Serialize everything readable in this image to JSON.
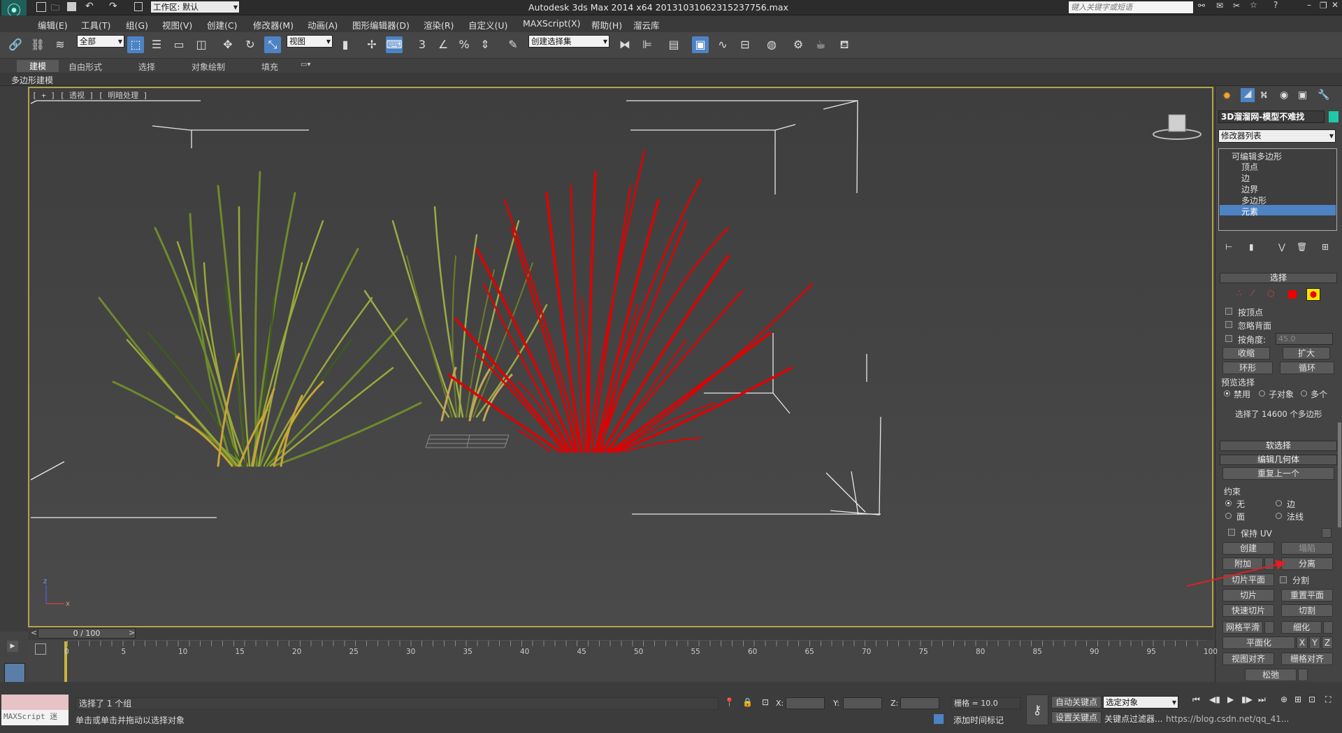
{
  "window": {
    "title": "Autodesk 3ds Max  2014 x64      20131031062315237756.max",
    "workspace": "工作区: 默认",
    "search_placeholder": "键入关键字或短语"
  },
  "menu": [
    "编辑(E)",
    "工具(T)",
    "组(G)",
    "视图(V)",
    "创建(C)",
    "修改器(M)",
    "动画(A)",
    "图形编辑器(D)",
    "渲染(R)",
    "自定义(U)",
    "MAXScript(X)",
    "帮助(H)",
    "溜云库"
  ],
  "toolbar": {
    "filter": "全部",
    "refcoord": "视图",
    "selection_set": "创建选择集"
  },
  "ribbon": {
    "tabs": [
      "建模",
      "自由形式",
      "选择",
      "对象绘制",
      "填充"
    ],
    "sub": "多边形建模"
  },
  "viewport": {
    "label": "[ + ] [ 透视 ] [ 明暗处理 ]",
    "axis_z": "z",
    "axis_x": "x"
  },
  "panel": {
    "object_name": "3D溜溜网-模型不难找",
    "modifier_list": "修改器列表",
    "stack": [
      "可编辑多边形",
      "顶点",
      "边",
      "边界",
      "多边形",
      "元素"
    ],
    "stack_selected": 5,
    "select": {
      "title": "选择",
      "by_vertex": "按顶点",
      "ignore_backface": "忽略背面",
      "by_angle": "按角度:",
      "angle_value": "45.0",
      "shrink": "收缩",
      "grow": "扩大",
      "ring": "环形",
      "loop": "循环",
      "preview": "预览选择",
      "disabled": "禁用",
      "subobject": "子对象",
      "multiple": "多个",
      "status": "选择了 14600 个多边形"
    },
    "soft_select": "软选择",
    "edit_geo": {
      "title": "编辑几何体",
      "repeat": "重复上一个",
      "constraint": "约束",
      "none": "无",
      "edge": "边",
      "face": "面",
      "normal": "法线",
      "keep_uv": "保持 UV",
      "create": "创建",
      "collapse": "塌陷",
      "attach": "附加",
      "detach": "分离",
      "slice_plane": "切片平面",
      "split": "分割",
      "slice": "切片",
      "reset_plane": "重置平面",
      "quick_slice": "快速切片",
      "cut": "切割",
      "meshsmooth": "网格平滑",
      "tessellate": "细化",
      "planarize": "平面化",
      "x": "X",
      "y": "Y",
      "z": "Z",
      "view_align": "视图对齐",
      "grid_align": "栅格对齐",
      "relax": "松弛"
    }
  },
  "timeline": {
    "frame": "0 / 100",
    "ticks": [
      "0",
      "5",
      "10",
      "15",
      "20",
      "25",
      "30",
      "35",
      "40",
      "45",
      "50",
      "55",
      "60",
      "65",
      "70",
      "75",
      "80",
      "85",
      "90",
      "95",
      "100"
    ]
  },
  "status": {
    "selected": "选择了 1 个组",
    "prompt": "单击或单击并拖动以选择对象",
    "maxscript": "MAXScript 迷",
    "x_label": "X:",
    "y_label": "Y:",
    "z_label": "Z:",
    "grid": "栅格 = 10.0",
    "auto_key": "自动关键点",
    "set_key": "设置关键点",
    "key_target": "选定对象",
    "add_time_tag": "添加时间标记",
    "key_filter": "关键点过滤器...",
    "watermark": "https://blog.csdn.net/qq_41..."
  },
  "colors": {
    "highlight": "#4d83c4",
    "viewport_border": "#b3a34a",
    "selected_grass": "#e00000"
  }
}
